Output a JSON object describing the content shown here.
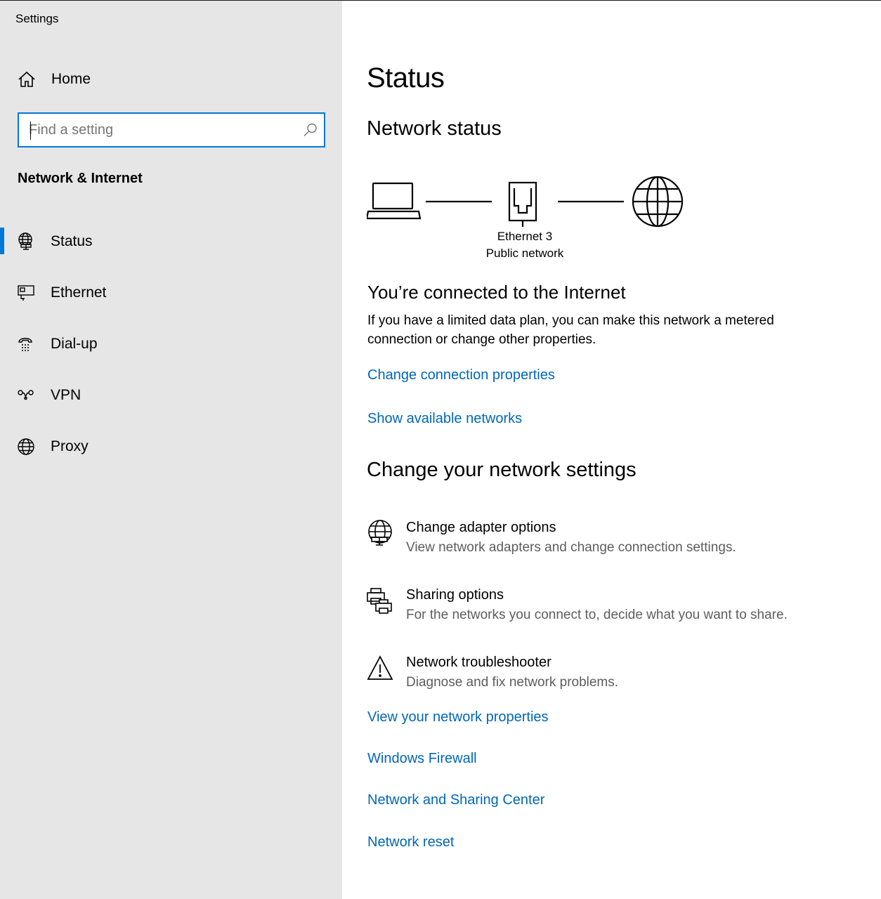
{
  "window": {
    "title": "Settings"
  },
  "sidebar": {
    "home_label": "Home",
    "search": {
      "placeholder": "Find a setting",
      "value": ""
    },
    "section_title": "Network & Internet",
    "items": [
      {
        "label": "Status",
        "icon": "status-globe-icon",
        "selected": true
      },
      {
        "label": "Ethernet",
        "icon": "ethernet-icon",
        "selected": false
      },
      {
        "label": "Dial-up",
        "icon": "dial-up-icon",
        "selected": false
      },
      {
        "label": "VPN",
        "icon": "vpn-icon",
        "selected": false
      },
      {
        "label": "Proxy",
        "icon": "globe-icon",
        "selected": false
      }
    ]
  },
  "main": {
    "page_title": "Status",
    "network_status_heading": "Network status",
    "network": {
      "name": "Ethernet 3",
      "type": "Public network"
    },
    "connected_heading": "You’re connected to the Internet",
    "connected_text": "If you have a limited data plan, you can make this network a metered connection or change other properties.",
    "links_top": [
      "Change connection properties",
      "Show available networks"
    ],
    "change_heading": "Change your network settings",
    "options": [
      {
        "title": "Change adapter options",
        "desc": "View network adapters and change connection settings.",
        "icon": "adapter-globe-icon"
      },
      {
        "title": "Sharing options",
        "desc": "For the networks you connect to, decide what you want to share.",
        "icon": "sharing-printers-icon"
      },
      {
        "title": "Network troubleshooter",
        "desc": "Diagnose and fix network problems.",
        "icon": "warning-icon"
      }
    ],
    "links_bottom": [
      "View your network properties",
      "Windows Firewall",
      "Network and Sharing Center",
      "Network reset"
    ]
  },
  "colors": {
    "accent": "#0078d7",
    "link": "#0067b8",
    "sidebar_bg": "#e6e6e6",
    "secondary_text": "#5d5d5d"
  }
}
